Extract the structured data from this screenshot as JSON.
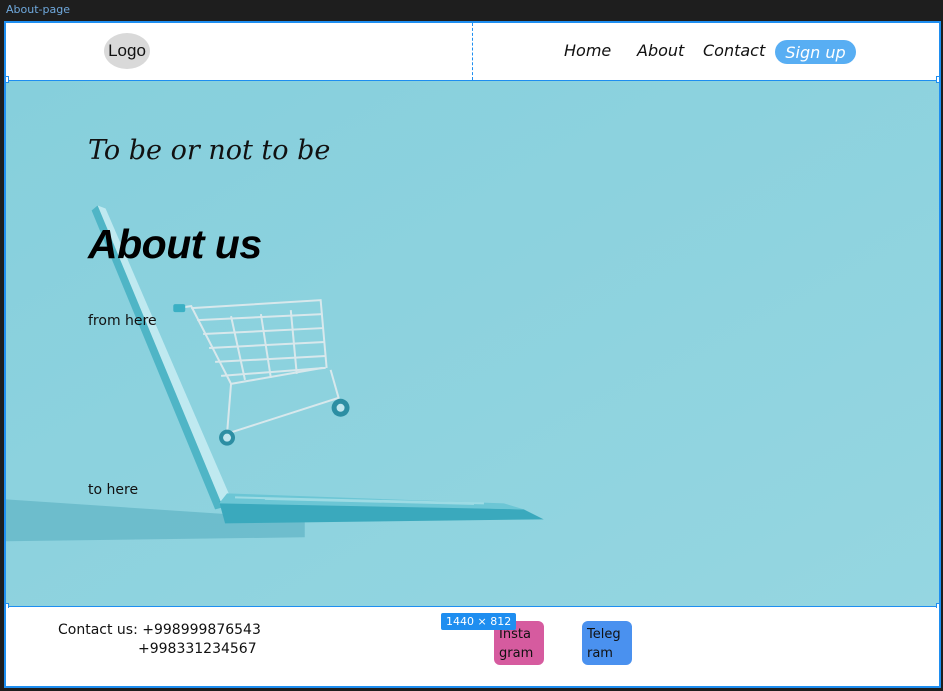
{
  "editor": {
    "frame_name": "About-page",
    "frame_size": "1440 × 812",
    "accent": "#1e8ef0"
  },
  "header": {
    "logo": "Logo",
    "nav": {
      "home": "Home",
      "about": "About",
      "contact": "Contact"
    },
    "signup": "Sign up"
  },
  "hero": {
    "tagline": "To be or not to be",
    "title": "About us",
    "from_text": "from here",
    "to_text": "to here",
    "background": "#8ed3df"
  },
  "footer": {
    "contact_line1": "Contact us: +998999876543",
    "contact_line2": "+998331234567",
    "instagram": {
      "line1": "Insta",
      "line2": "gram",
      "color": "#d65b9f"
    },
    "telegram": {
      "line1": "Teleg",
      "line2": "ram",
      "color": "#4a91ef"
    }
  }
}
